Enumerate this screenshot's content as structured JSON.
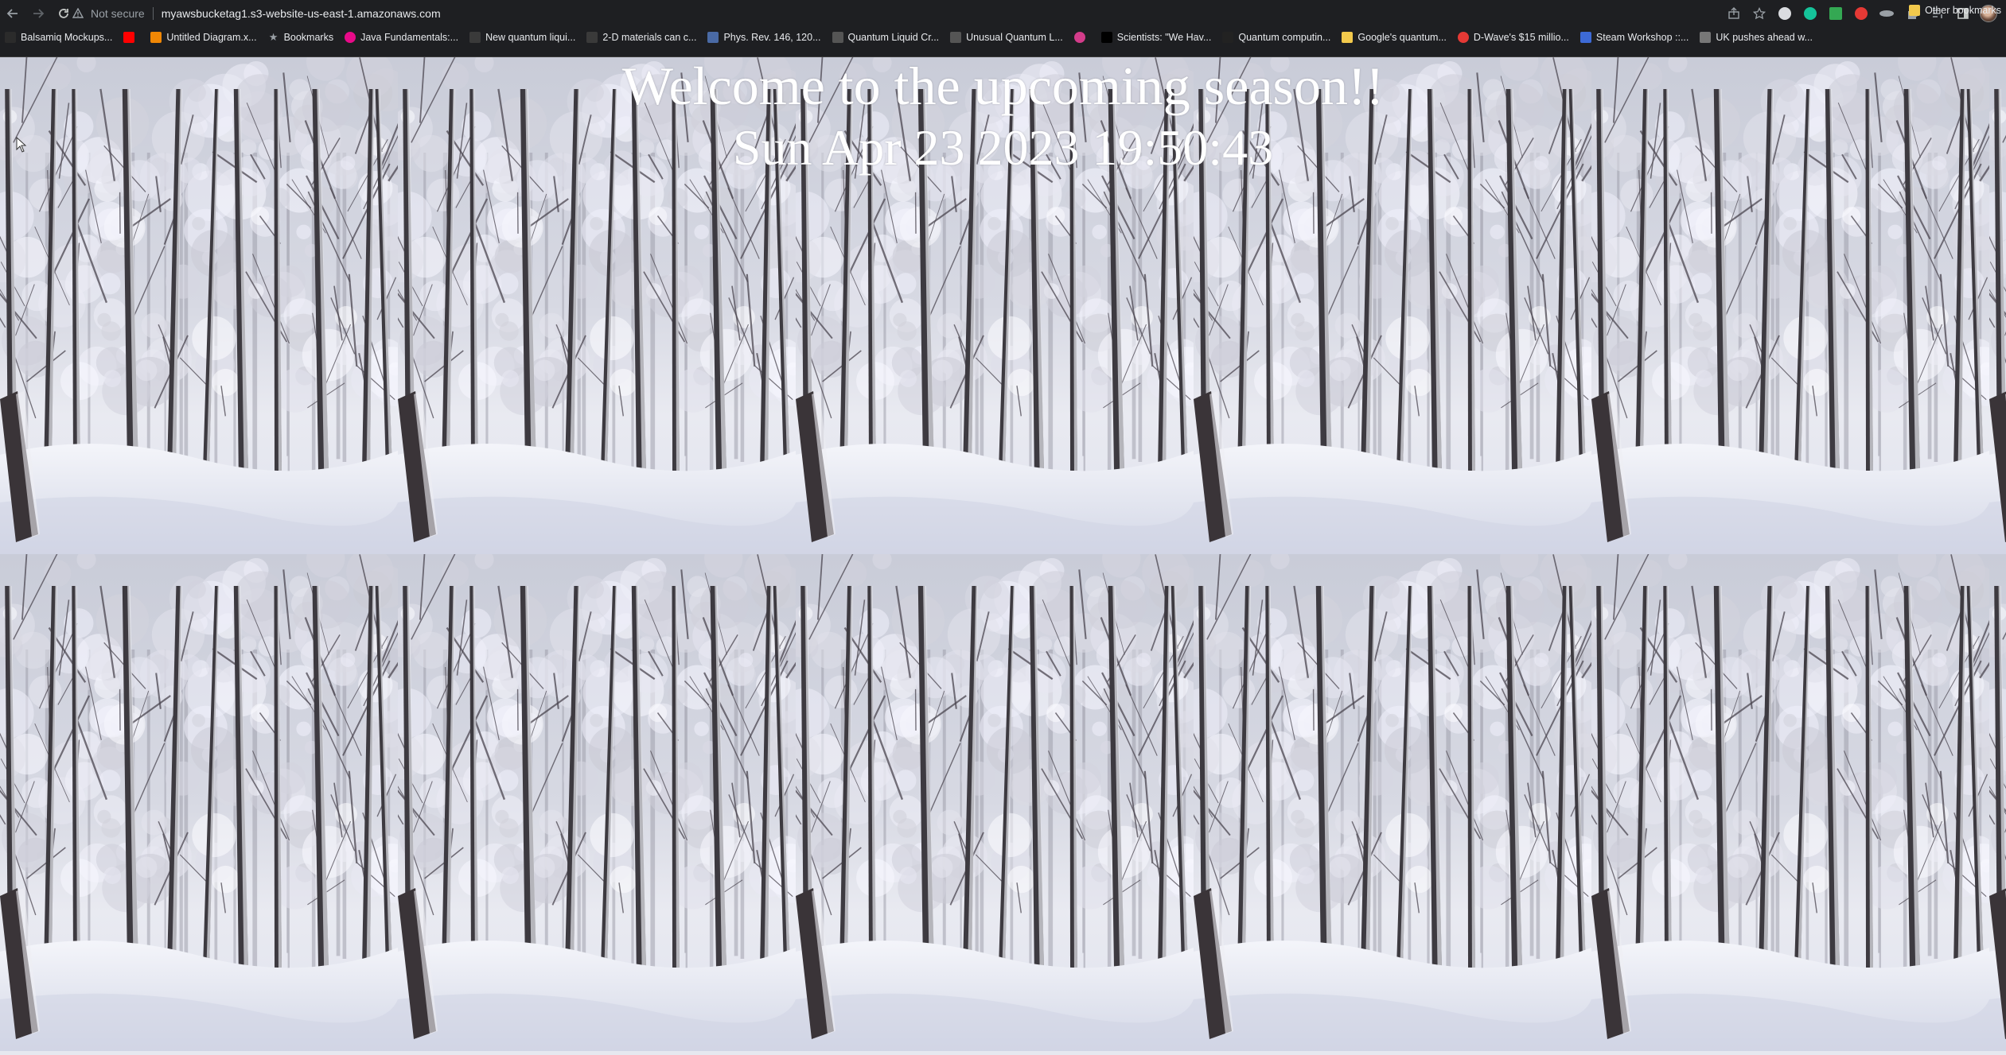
{
  "browser": {
    "security_label": "Not secure",
    "url": "myawsbucketag1.s3-website-us-east-1.amazonaws.com",
    "bookmarks": [
      {
        "label": "Balsamiq Mockups...",
        "icon": "balsamiq-icon",
        "color": "#2b2b2b"
      },
      {
        "label": "",
        "icon": "youtube-icon",
        "color": "#ff0000"
      },
      {
        "label": "Untitled Diagram.x...",
        "icon": "drawio-icon",
        "color": "#f08705"
      },
      {
        "label": "Bookmarks",
        "icon": "star-icon",
        "color": "#9aa0a6"
      },
      {
        "label": "Java Fundamentals:...",
        "icon": "pluralsight-icon",
        "color": "#e80a89"
      },
      {
        "label": "New quantum liqui...",
        "icon": "sd-icon",
        "color": "#3a3a3a"
      },
      {
        "label": "2-D materials can c...",
        "icon": "sd-icon",
        "color": "#3a3a3a"
      },
      {
        "label": "Phys. Rev. 146, 120...",
        "icon": "aps-icon",
        "color": "#4a6aa5"
      },
      {
        "label": "Quantum Liquid Cr...",
        "icon": "ieee-icon",
        "color": "#555555"
      },
      {
        "label": "Unusual Quantum L...",
        "icon": "ieee-icon",
        "color": "#555555"
      },
      {
        "label": "",
        "icon": "circle-icon",
        "color": "#d33c8a"
      },
      {
        "label": "Scientists: \"We Hav...",
        "icon": "forbes-icon",
        "color": "#000000"
      },
      {
        "label": "Quantum computin...",
        "icon": "wsj-icon",
        "color": "#222222"
      },
      {
        "label": "Google's quantum...",
        "icon": "folder-icon",
        "color": "#f2c94c"
      },
      {
        "label": "D-Wave's $15 millio...",
        "icon": "power-icon",
        "color": "#e53935"
      },
      {
        "label": "Steam Workshop ::...",
        "icon": "steam-icon",
        "color": "#3d6ad6"
      },
      {
        "label": "UK pushes ahead w...",
        "icon": "dots-icon",
        "color": "#777777"
      }
    ],
    "more_label": "»",
    "other_bookmarks": "Other bookmarks"
  },
  "page": {
    "title": "Welcome to the upcoming season!!",
    "clock": "Sun Apr 23 2023 19:50:43",
    "background_image": "snowy-forest-tile"
  }
}
